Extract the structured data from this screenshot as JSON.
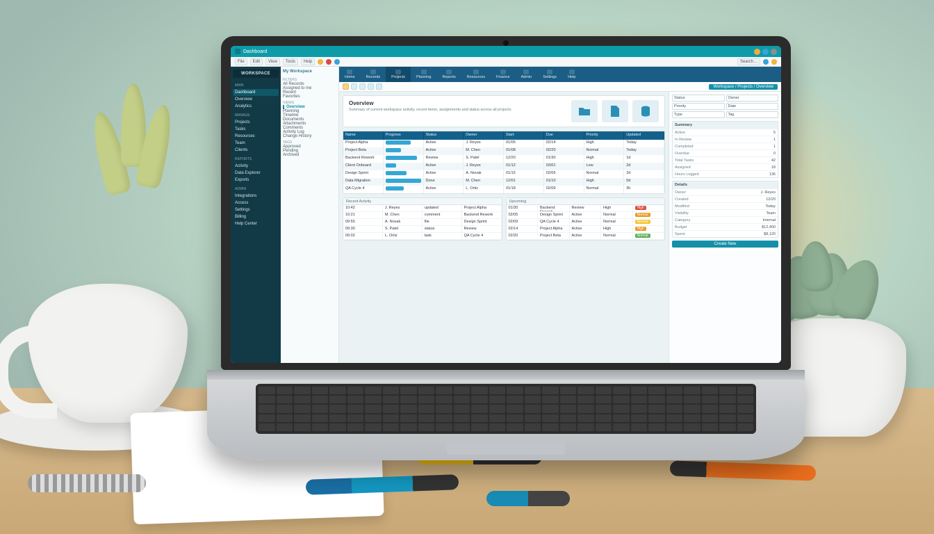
{
  "title": "Dashboard",
  "toolbar_buttons": [
    "File",
    "Edit",
    "View",
    "Tools",
    "Help"
  ],
  "sidebar_logo": "WORKSPACE",
  "sidebar": {
    "sections": [
      {
        "header": "Main",
        "items": [
          "Dashboard",
          "Overview",
          "Analytics"
        ]
      },
      {
        "header": "Manage",
        "items": [
          "Projects",
          "Tasks",
          "Resources",
          "Team",
          "Clients"
        ]
      },
      {
        "header": "Reports",
        "items": [
          "Activity",
          "Data Explorer",
          "Exports"
        ]
      },
      {
        "header": "Admin",
        "items": [
          "Integrations",
          "Access",
          "Settings",
          "Billing",
          "Help Center"
        ]
      }
    ],
    "active": "Dashboard"
  },
  "sidebar2": {
    "breadcrumb": "My Workspace",
    "groups": [
      {
        "header": "FILTERS",
        "items": [
          "All Records",
          "Assigned to me",
          "Recent",
          "Favorites"
        ]
      },
      {
        "header": "VIEWS",
        "items": [
          "Overview",
          "Planning",
          "Timeline",
          "Documents",
          "Attachments",
          "Comments",
          "Activity Log",
          "Change History"
        ]
      },
      {
        "header": "TAGS",
        "items": [
          "Approved",
          "Pending",
          "Archived"
        ]
      }
    ],
    "active": "Overview"
  },
  "ribbon": [
    "Home",
    "Records",
    "Projects",
    "Planning",
    "Reports",
    "Resources",
    "Finance",
    "Admin",
    "Settings",
    "Help"
  ],
  "ribbon_active": "Projects",
  "crumb": "Workspace / Projects / Overview",
  "overview": {
    "title": "Overview",
    "desc": "Summary of current workspace activity, recent items, assignments and status across all projects."
  },
  "grid": {
    "cols": [
      "Name",
      "Progress",
      "Status",
      "Owner",
      "Start",
      "Due",
      "Priority",
      "Updated"
    ],
    "rows": [
      {
        "name": "Project Alpha",
        "prog": 72,
        "status": "Active",
        "owner": "J. Reyes",
        "start": "01/05",
        "due": "02/14",
        "priority": "High",
        "updated": "Today"
      },
      {
        "name": "Project Beta",
        "prog": 44,
        "status": "Active",
        "owner": "M. Chen",
        "start": "01/08",
        "due": "02/20",
        "priority": "Normal",
        "updated": "Today"
      },
      {
        "name": "Backend Rework",
        "prog": 90,
        "status": "Review",
        "owner": "S. Patel",
        "start": "12/20",
        "due": "01/30",
        "priority": "High",
        "updated": "1d"
      },
      {
        "name": "Client Onboard",
        "prog": 30,
        "status": "Active",
        "owner": "J. Reyes",
        "start": "01/12",
        "due": "03/01",
        "priority": "Low",
        "updated": "2d"
      },
      {
        "name": "Design Sprint",
        "prog": 60,
        "status": "Active",
        "owner": "A. Novak",
        "start": "01/15",
        "due": "02/05",
        "priority": "Normal",
        "updated": "2d"
      },
      {
        "name": "Data Migration",
        "prog": 100,
        "status": "Done",
        "owner": "M. Chen",
        "start": "12/01",
        "due": "01/10",
        "priority": "High",
        "updated": "5d"
      },
      {
        "name": "QA Cycle 4",
        "prog": 52,
        "status": "Active",
        "owner": "L. Ortiz",
        "start": "01/18",
        "due": "02/09",
        "priority": "Normal",
        "updated": "3h"
      }
    ]
  },
  "lower": {
    "left": {
      "title": "Recent Activity",
      "rows": [
        [
          "10:42",
          "J. Reyes",
          "updated",
          "Project Alpha"
        ],
        [
          "10:21",
          "M. Chen",
          "comment",
          "Backend Rework"
        ],
        [
          "09:55",
          "A. Novak",
          "file",
          "Design Sprint"
        ],
        [
          "09:30",
          "S. Patel",
          "status",
          "Review"
        ],
        [
          "09:02",
          "L. Ortiz",
          "task",
          "QA Cycle 4"
        ]
      ]
    },
    "right": {
      "title": "Upcoming",
      "rows": [
        [
          "01/30",
          "Backend Rework",
          "Review",
          "High",
          "r"
        ],
        [
          "02/05",
          "Design Sprint",
          "Active",
          "Normal",
          "o"
        ],
        [
          "02/09",
          "QA Cycle 4",
          "Active",
          "Normal",
          "y"
        ],
        [
          "02/14",
          "Project Alpha",
          "Active",
          "High",
          "o"
        ],
        [
          "02/20",
          "Project Beta",
          "Active",
          "Normal",
          "g"
        ]
      ]
    }
  },
  "right": {
    "filters": [
      "Status",
      "Owner",
      "Priority",
      "Date",
      "Type",
      "Tag"
    ],
    "summary": {
      "title": "Summary",
      "rows": [
        [
          "Active",
          "5"
        ],
        [
          "In Review",
          "1"
        ],
        [
          "Completed",
          "1"
        ],
        [
          "Overdue",
          "0"
        ],
        [
          "Total Tasks",
          "42"
        ],
        [
          "Assigned",
          "18"
        ],
        [
          "Hours Logged",
          "136"
        ]
      ]
    },
    "details": {
      "title": "Details",
      "rows": [
        [
          "Owner",
          "J. Reyes"
        ],
        [
          "Created",
          "12/20"
        ],
        [
          "Modified",
          "Today"
        ],
        [
          "Visibility",
          "Team"
        ],
        [
          "Category",
          "Internal"
        ],
        [
          "Budget",
          "$12,400"
        ],
        [
          "Spent",
          "$8,120"
        ]
      ]
    },
    "action": "Create New"
  }
}
